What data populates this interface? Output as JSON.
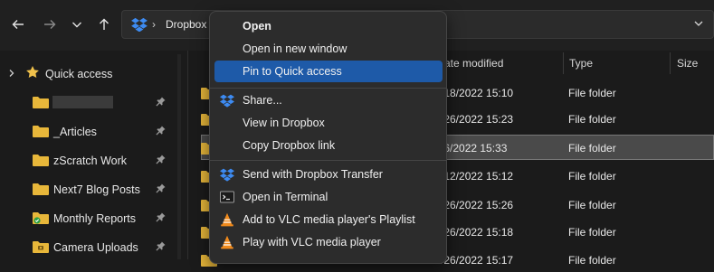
{
  "address": {
    "path_root": "Dropbox"
  },
  "sidebar": {
    "quick_access_label": "Quick access",
    "items": [
      {
        "label": "",
        "redacted": true
      },
      {
        "label": "_Articles"
      },
      {
        "label": "zScratch Work"
      },
      {
        "label": "Next7 Blog Posts"
      },
      {
        "label": "Monthly Reports"
      },
      {
        "label": "Camera Uploads"
      }
    ]
  },
  "columns": {
    "date_modified": "ate modified",
    "type": "Type",
    "size": "Size"
  },
  "rows": [
    {
      "date": "/18/2022 15:10",
      "type": "File folder"
    },
    {
      "date": "/26/2022 15:23",
      "type": "File folder"
    },
    {
      "date": "/6/2022 15:33",
      "type": "File folder",
      "selected": true
    },
    {
      "date": "/12/2022 15:12",
      "type": "File folder"
    },
    {
      "date": "/26/2022 15:26",
      "type": "File folder"
    },
    {
      "date": "/26/2022 15:18",
      "type": "File folder"
    },
    {
      "date": "/26/2022 15:17",
      "type": "File folder"
    }
  ],
  "context_menu": {
    "items": [
      {
        "label": "Open",
        "icon": "none",
        "bold": true
      },
      {
        "label": "Open in new window",
        "icon": "none"
      },
      {
        "label": "Pin to Quick access",
        "icon": "none",
        "highlighted": true
      },
      {
        "label": "Share...",
        "icon": "dropbox-icon"
      },
      {
        "label": "View in Dropbox",
        "icon": "none"
      },
      {
        "label": "Copy Dropbox link",
        "icon": "none"
      },
      {
        "label": "Send with Dropbox Transfer",
        "icon": "dropbox-icon"
      },
      {
        "label": "Open in Terminal",
        "icon": "terminal-icon"
      },
      {
        "label": "Add to VLC media player's Playlist",
        "icon": "vlc-icon"
      },
      {
        "label": "Play with VLC media player",
        "icon": "vlc-icon"
      }
    ]
  },
  "colors": {
    "accent_highlight": "#1e5aa8",
    "folder": "#e8b73a",
    "dropbox": "#3d8bf2",
    "vlc": "#f08a1c"
  }
}
